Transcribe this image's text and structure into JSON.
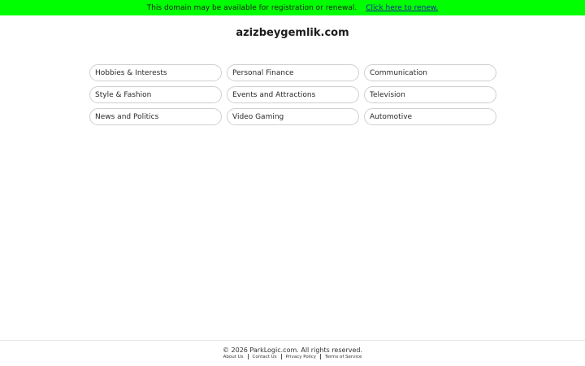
{
  "banner": {
    "message": "This domain may be available for registration or renewal.",
    "link_label": "Click here to renew.",
    "background_color": "#00ff00"
  },
  "site": {
    "title": "azizbeygemlik.com"
  },
  "categories": [
    "Hobbies & Interests",
    "Personal Finance",
    "Communication",
    "Style & Fashion",
    "Events and Attractions",
    "Television",
    "News and Politics",
    "Video Gaming",
    "Automotive"
  ],
  "footer": {
    "copyright": "© 2026 ParkLogic.com. All rights reserved.",
    "links": [
      "About Us",
      "Contact Us",
      "Privacy Policy",
      "Terms of Service"
    ]
  }
}
